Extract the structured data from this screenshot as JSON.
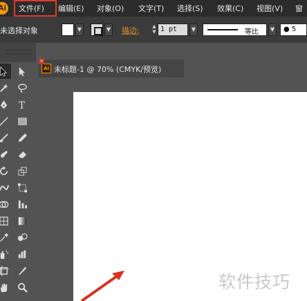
{
  "menu": {
    "items": [
      "文件(F)",
      "编辑(E)",
      "对象(O)",
      "文字(T)",
      "选择(S)",
      "效果(C)",
      "视图(V)",
      "窗"
    ],
    "highlighted": "文件(F)",
    "highlight_color": "#e23a2a"
  },
  "app": {
    "logo_color": "#ff9a00"
  },
  "control_bar": {
    "selection_status": "未选择对象",
    "stroke_label": "描边:",
    "stroke_label_color": "#e8962c",
    "stroke_weight": "1 pt",
    "profile_label": "等比",
    "brush_size": "5"
  },
  "tools": {
    "icons": [
      "selection-tool-icon",
      "direct-selection-tool-icon",
      "magic-wand-icon",
      "lasso-icon",
      "pen-tool-icon",
      "type-tool-icon",
      "line-segment-icon",
      "rectangle-tool-icon",
      "paintbrush-icon",
      "pencil-icon",
      "blob-brush-icon",
      "eraser-icon",
      "rotate-tool-icon",
      "scale-tool-icon",
      "warp-tool-icon",
      "free-transform-icon",
      "shape-builder-icon",
      "perspective-grid-icon",
      "mesh-tool-icon",
      "gradient-tool-icon",
      "eyedropper-icon",
      "blend-tool-icon",
      "symbol-sprayer-icon",
      "graph-tool-icon",
      "artboard-tool-icon",
      "slice-tool-icon",
      "hand-tool-icon",
      "zoom-tool-icon"
    ]
  },
  "document": {
    "tab_title": "未标题-1 @ 70% (CMYK/预览)",
    "file_badge": "Ai"
  },
  "watermark": "软件技巧"
}
